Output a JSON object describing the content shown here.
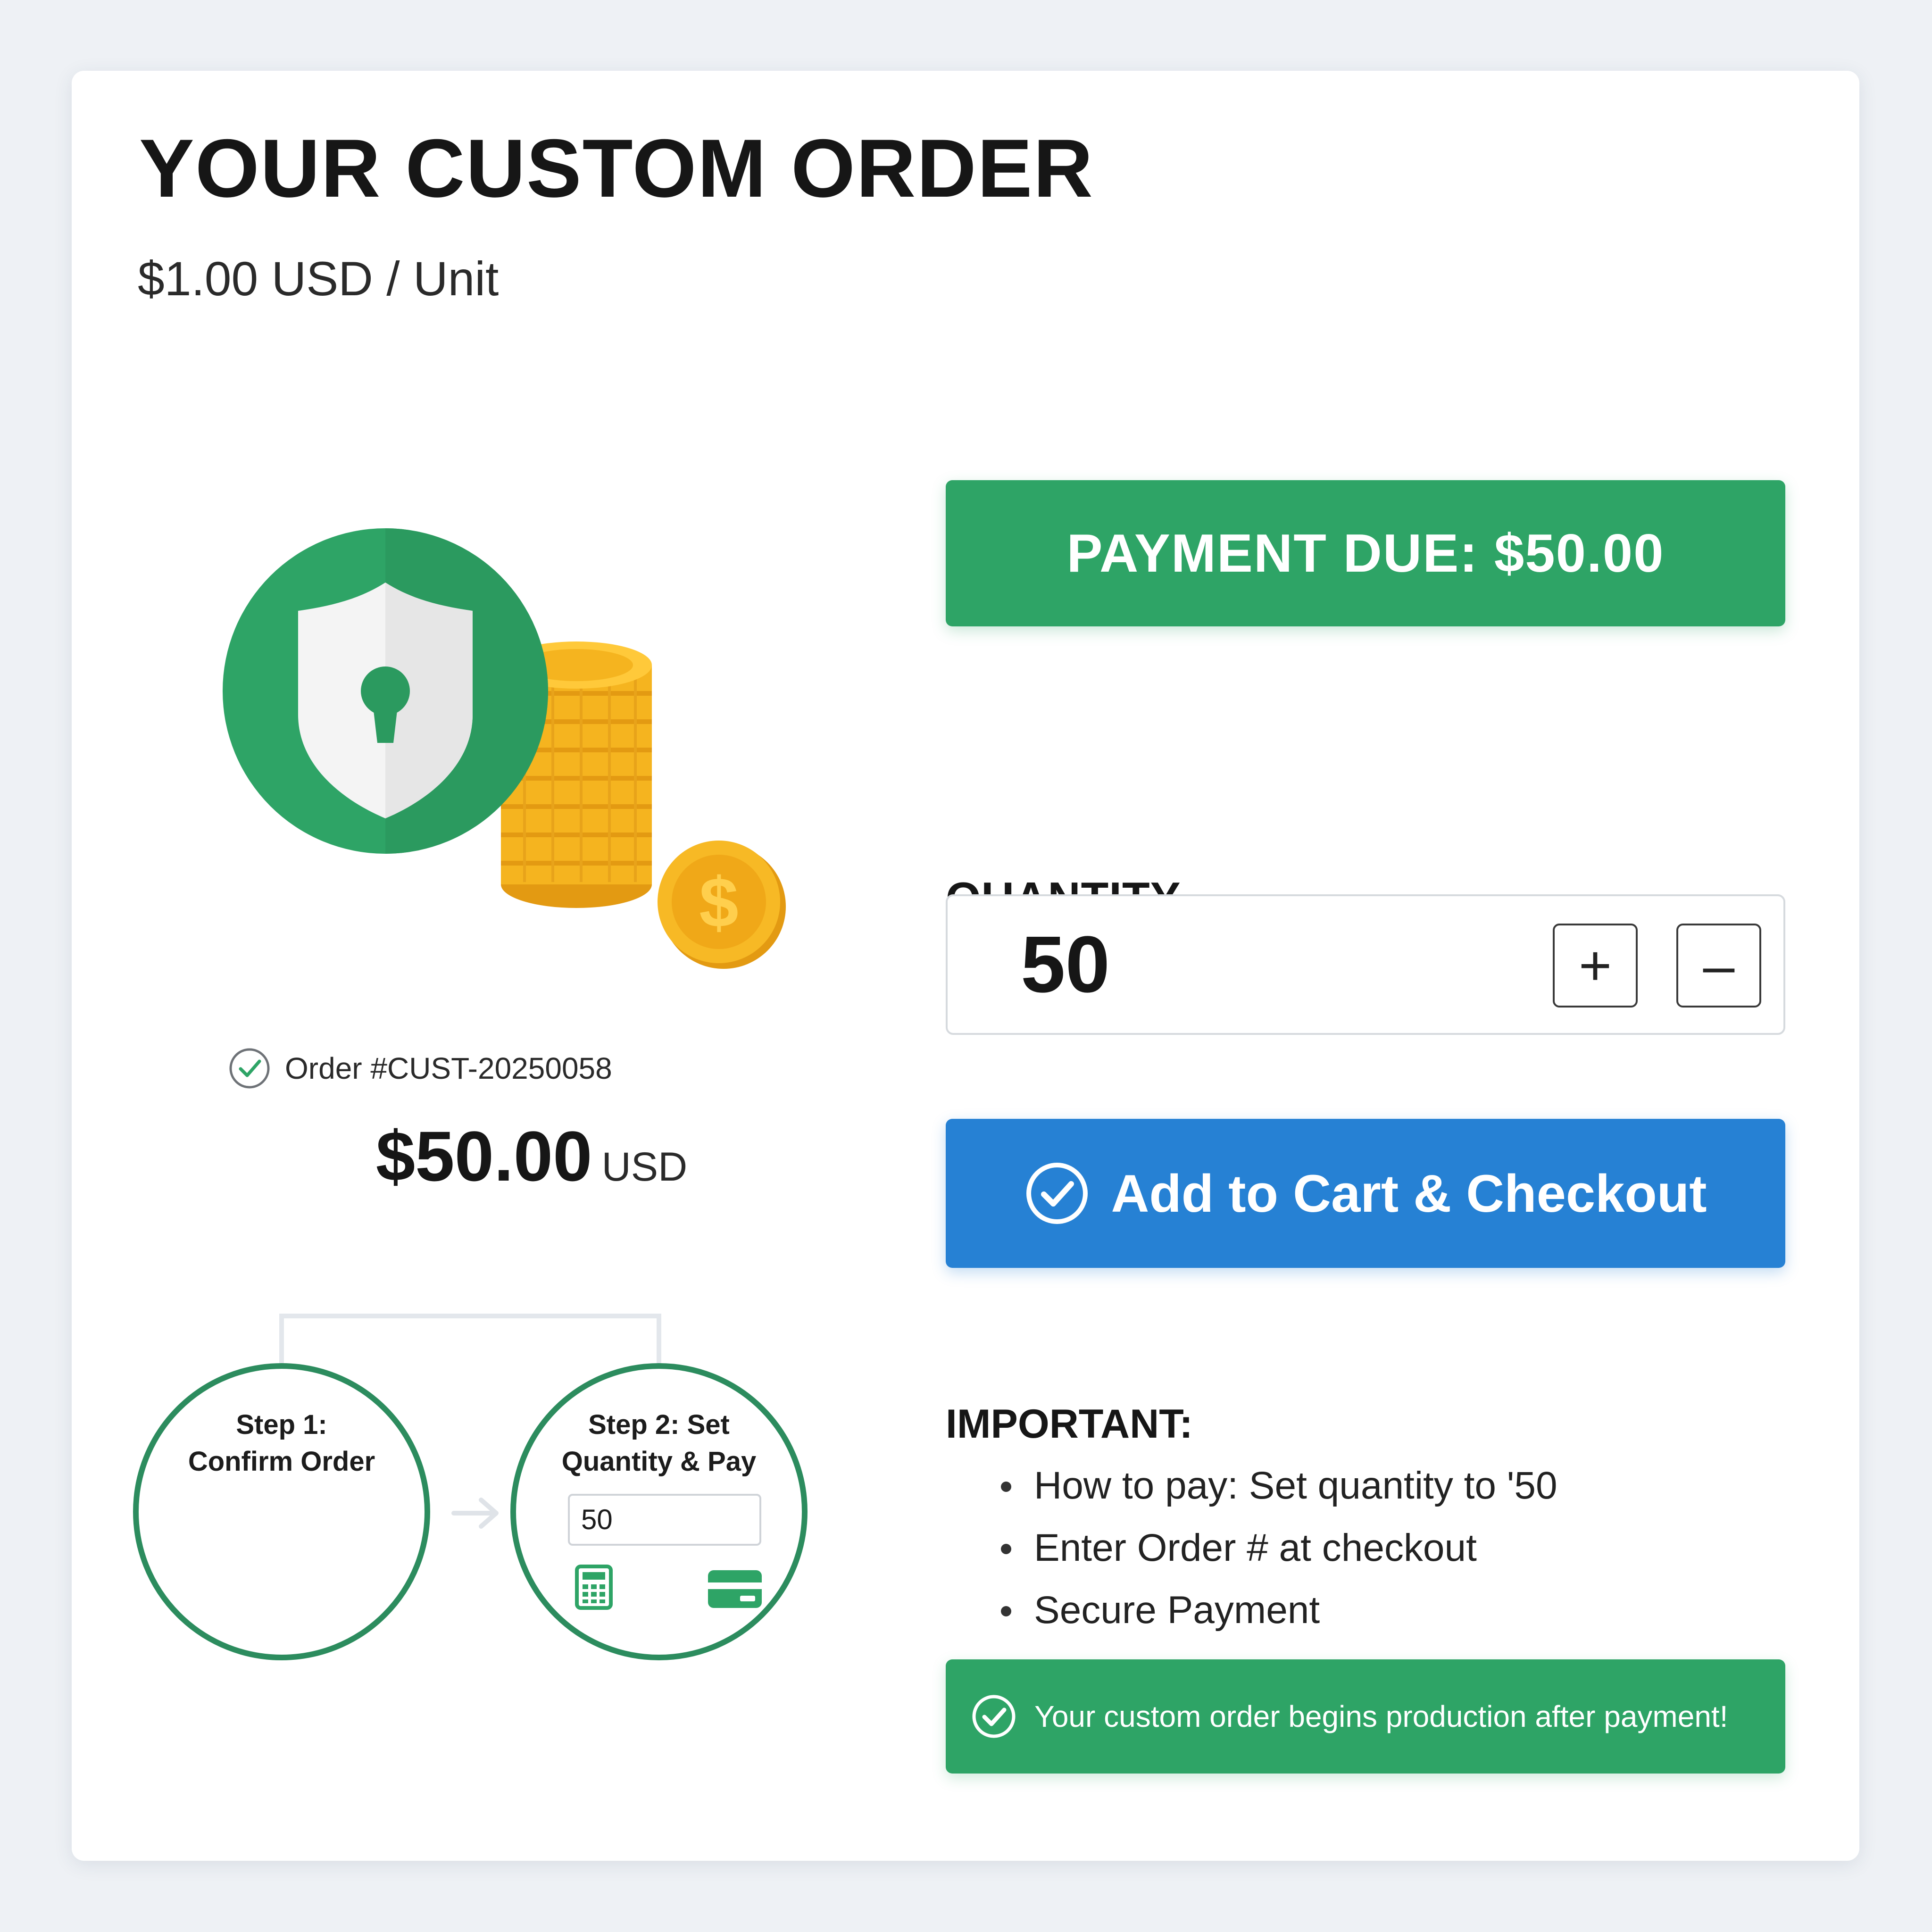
{
  "header": {
    "title": "YOUR CUSTOM ORDER",
    "unit_price": "$1.00 USD / Unit"
  },
  "summary": {
    "order_label": "Order #CUST-20250058",
    "total_amount": "$50.00",
    "total_currency": "USD"
  },
  "steps": [
    {
      "line1": "Step 1:",
      "line2": "Confirm Order"
    },
    {
      "line1": "Step 2: Set",
      "line2": "Quantity & Pay",
      "input_value": "50"
    }
  ],
  "payment": {
    "due_label": "PAYMENT DUE: $50.00"
  },
  "quantity": {
    "label": "QUANTITY",
    "value": "50",
    "increment_symbol": "+",
    "decrement_symbol": "–"
  },
  "checkout": {
    "button_label": "Add to Cart & Checkout"
  },
  "important": {
    "label": "IMPORTANT:",
    "items": [
      "How to pay: Set quantity to '50",
      "Enter Order # at checkout",
      "Secure Payment"
    ]
  },
  "notice": {
    "text": "Your custom order begins production after payment!"
  },
  "icons": {
    "hero": "shield-lock-coins-icon",
    "order_check": "check-circle-icon",
    "step_calculator": "calculator-icon",
    "step_card": "credit-card-icon",
    "step_arrow": "arrow-right-icon",
    "checkout_check": "check-circle-icon",
    "notice_check": "check-circle-icon"
  },
  "colors": {
    "accent_green": "#2ea466",
    "accent_blue": "#2681d4",
    "coin_gold": "#f5b41f",
    "background": "#eef1f5"
  }
}
